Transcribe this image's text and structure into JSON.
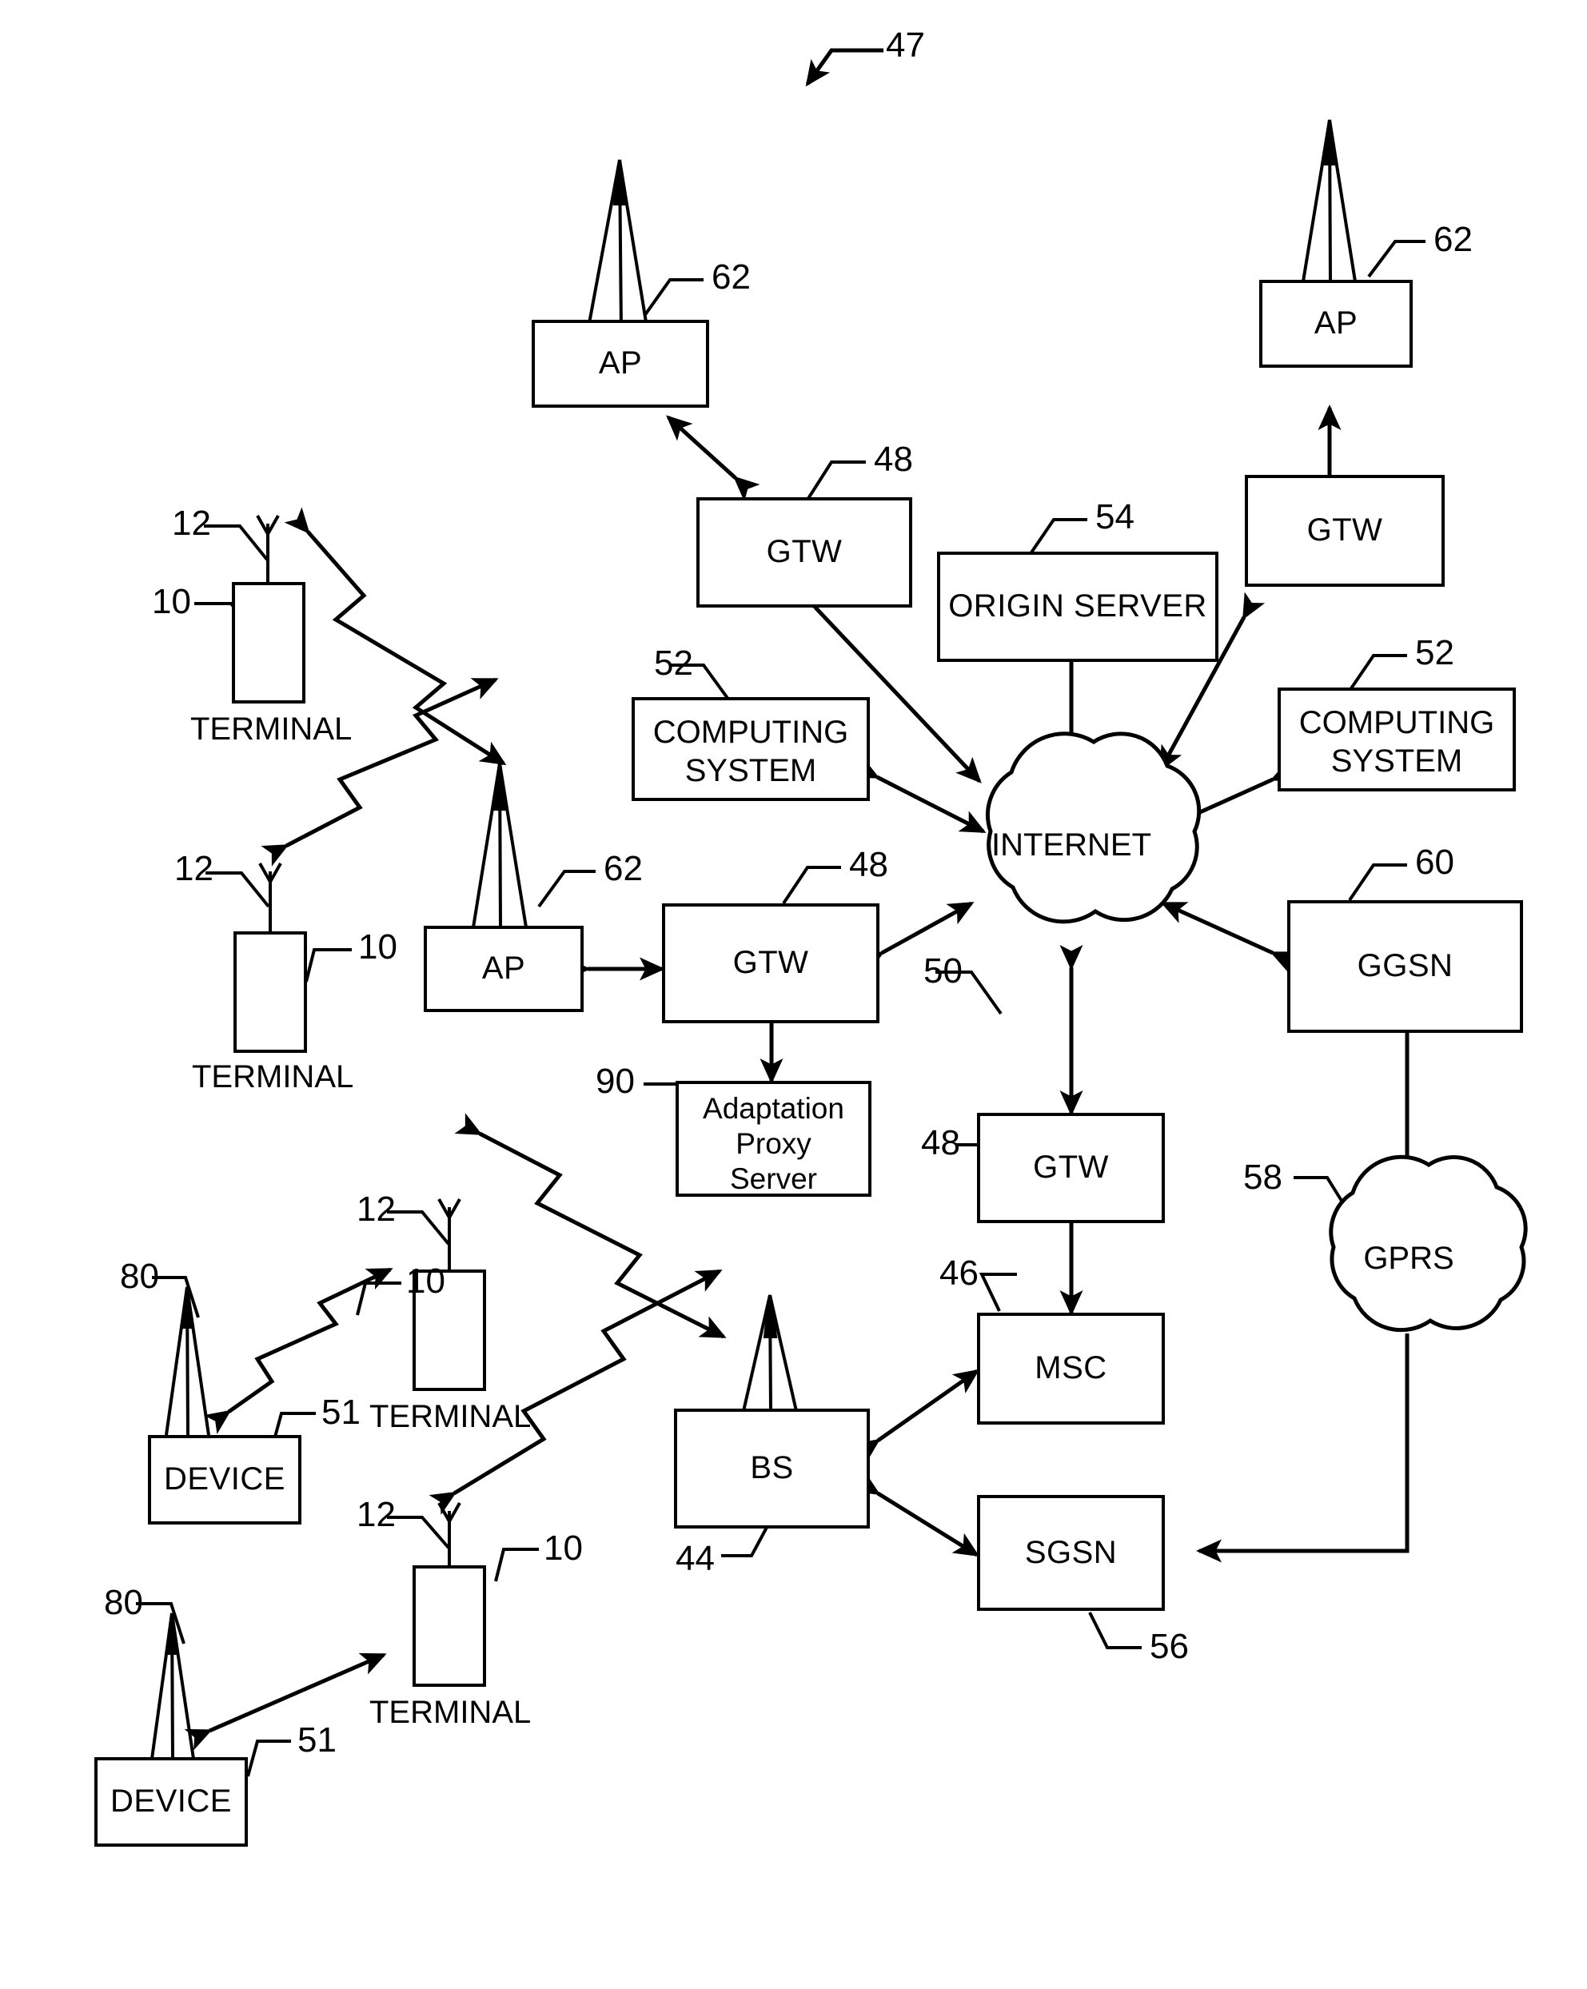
{
  "figure": {
    "ref": "47"
  },
  "nodes": {
    "ap_top_left": {
      "label": "AP",
      "ref": "62"
    },
    "ap_top_right": {
      "label": "AP",
      "ref": "62"
    },
    "ap_mid_left": {
      "label": "AP",
      "ref": "62"
    },
    "gtw_top_left": {
      "label": "GTW",
      "ref": "48"
    },
    "gtw_top_right": {
      "label": "GTW",
      "ref": ""
    },
    "gtw_mid": {
      "label": "GTW",
      "ref": "48"
    },
    "gtw_bottom": {
      "label": "GTW",
      "ref": "48"
    },
    "origin_server": {
      "label": "ORIGIN SERVER",
      "ref": "54"
    },
    "computing_left": {
      "label": "COMPUTING SYSTEM",
      "ref": "52"
    },
    "computing_right": {
      "label": "COMPUTING SYSTEM",
      "ref": "52"
    },
    "internet": {
      "label": "INTERNET",
      "ref": "50"
    },
    "gprs": {
      "label": "GPRS",
      "ref": "58"
    },
    "ggsn": {
      "label": "GGSN",
      "ref": "60"
    },
    "msc": {
      "label": "MSC",
      "ref": "46"
    },
    "sgsn": {
      "label": "SGSN",
      "ref": "56"
    },
    "bs": {
      "label": "BS",
      "ref": "44"
    },
    "adaptation_proxy": {
      "label": "Adaptation Proxy Server",
      "ref": "90"
    },
    "terminal_1": {
      "label": "TERMINAL",
      "body_ref": "10",
      "antenna_ref": "12"
    },
    "terminal_2": {
      "label": "TERMINAL",
      "body_ref": "10",
      "antenna_ref": "12"
    },
    "terminal_3": {
      "label": "TERMINAL",
      "body_ref": "10",
      "antenna_ref": "12"
    },
    "terminal_4": {
      "label": "TERMINAL",
      "body_ref": "10",
      "antenna_ref": "12"
    },
    "device_1": {
      "label": "DEVICE",
      "body_ref": "51",
      "antenna_ref": "80"
    },
    "device_2": {
      "label": "DEVICE",
      "body_ref": "51",
      "antenna_ref": "80"
    }
  },
  "adaptation_proxy_lines": [
    "Adaptation",
    "Proxy",
    "Server"
  ],
  "computing_system_lines": [
    "COMPUTING",
    "SYSTEM"
  ],
  "colors": {
    "ink": "#000000",
    "paper": "#ffffff"
  }
}
